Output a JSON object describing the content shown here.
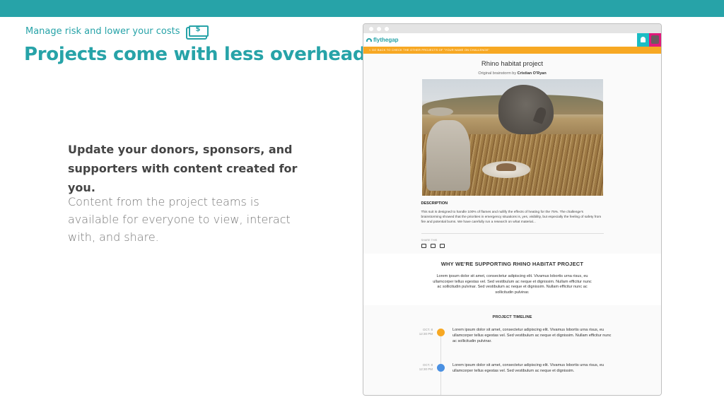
{
  "slide": {
    "kicker": "Manage risk and lower your costs",
    "kicker_icon": "money-icon",
    "headline": "Projects come with less overhead",
    "lead": "Update your donors, sponsors, and supporters with content created for you.",
    "body": "Content from the project teams is available for everyone to view, interact with, and share.",
    "accent_color": "#27a3a8"
  },
  "site": {
    "logo_text": "flythegap",
    "back_link": "< GO BACK TO CHECK THE OTHER PROJECTS OF \"YOUR NAME ON CHALLENGE\"",
    "project_title": "Rhino habitat project",
    "by_prefix": "Original brainstorm by",
    "by_author": "Cristian O'Ryan",
    "description_heading": "DESCRIPTION",
    "description_text": "This suit is designed to handle 100% of flames and nullify the effects of heating for the 75%. The challenge's brainstorming showed that the priorities in emergency situations is, yes, visibility, but especially the feeling of safety from fire and potential burns. We have carefully run a research on what material...",
    "share_label": "SHARE THIS",
    "why_heading": "WHY WE'RE SUPPORTING RHINO HABITAT PROJECT",
    "why_text": "Lorem ipsum dolor sit amet, consectetur adipiscing elit. Vivamus lobortis urna risus, eu ullamcorper tellus egestas vel. Sed vestibulum ac neque et dignissim. Nullam efficitur nunc ac sollicitudin pulvinar. Sed vestibulum ac neque et dignissim. Nullam efficitur nunc ac sollicitudin pulvinar.",
    "timeline_heading": "PROJECT TIMELINE",
    "timeline": [
      {
        "date": "OCT. 8",
        "time": "12:30 PM",
        "color": "#f7a823",
        "text": "Lorem ipsum dolor sit amet, consectetur adipiscing elit. Vivamus lobortis urna risus, eu ullamcorper tellus egestas vel. Sed vestibulum ac neque et dignissim. Nullam efficitur nunc ac sollicitudin pulvinar."
      },
      {
        "date": "OCT. 8",
        "time": "12:30 PM",
        "color": "#4a90e2",
        "text": "Lorem ipsum dolor sit amet, consectetur adipiscing elit. Vivamus lobortis urna risus, eu ullamcorper tellus egestas vel. Sed vestibulum ac neque et dignissim."
      }
    ]
  }
}
